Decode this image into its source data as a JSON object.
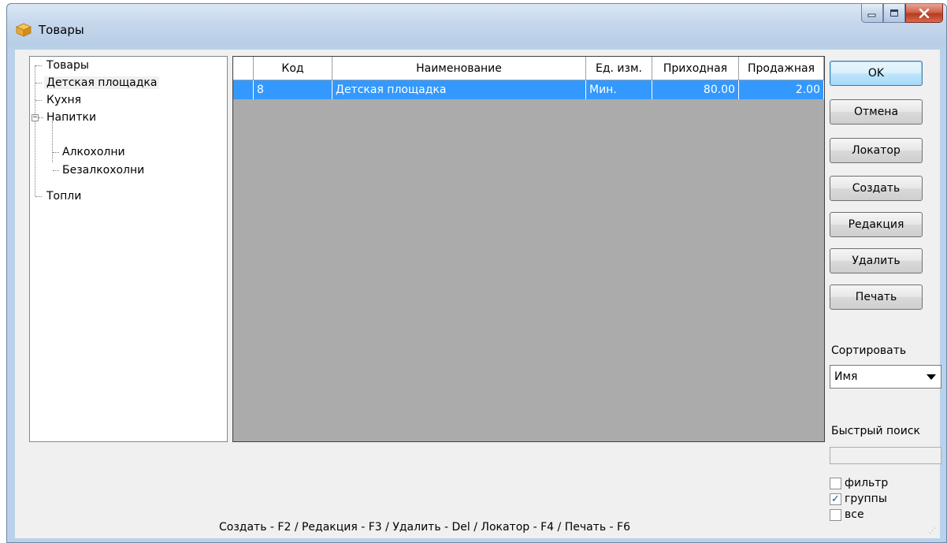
{
  "window": {
    "title": "Товары",
    "colors": {
      "selection": "#3399ff",
      "grid_background": "#ababab",
      "frame": "#b9d1ea"
    }
  },
  "caption_buttons": {
    "minimize_icon": "minimize-icon",
    "maximize_icon": "maximize-icon",
    "close_icon": "close-icon"
  },
  "tree": {
    "items": [
      {
        "label": "Товары"
      },
      {
        "label": "Детская площадка",
        "selected": true
      },
      {
        "label": "Кухня"
      },
      {
        "label": "Напитки",
        "expanded": true
      },
      {
        "label": "Алкохолни"
      },
      {
        "label": "Безалкохолни"
      },
      {
        "label": "Топли"
      }
    ]
  },
  "grid": {
    "columns": [
      "Код",
      "Наименование",
      "Ед. изм.",
      "Приходная",
      "Продажная"
    ],
    "rows": [
      {
        "code": "8",
        "name": "Детская площадка",
        "unit": "Мин.",
        "purchase": "80.00",
        "sale": "2.00",
        "selected": true
      }
    ]
  },
  "buttons": {
    "ok": "OK",
    "cancel": "Отмена",
    "locator": "Локатор",
    "create": "Создать",
    "edit": "Редакция",
    "delete": "Удалить",
    "print": "Печать"
  },
  "sort": {
    "label": "Сортировать",
    "selected": "Имя"
  },
  "quick_search": {
    "label": "Быстрый поиск",
    "value": ""
  },
  "checkboxes": [
    {
      "label": "фильтр",
      "checked": false
    },
    {
      "label": "группы",
      "checked": true
    },
    {
      "label": "все",
      "checked": false
    }
  ],
  "status_bar": {
    "hotkeys": "Создать - F2 / Редакция - F3 / Удалить - Del / Локатор - F4 / Печать - F6"
  }
}
